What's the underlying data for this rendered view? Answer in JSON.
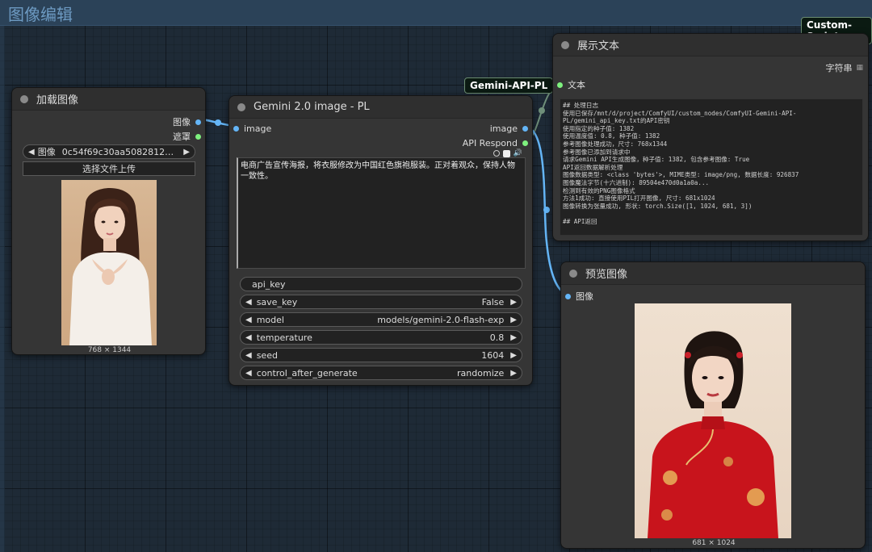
{
  "group": {
    "title": "图像编辑"
  },
  "badges": {
    "custom_scripts": "Custom-Scripts",
    "gemini_api": "Gemini-API-PL"
  },
  "load_image": {
    "title": "加载图像",
    "outputs": [
      "图像",
      "遮罩"
    ],
    "image_label": "图像",
    "image_value": "0c54f69c30aa508281210...",
    "upload_label": "选择文件上传",
    "dims": "768 × 1344"
  },
  "gemini": {
    "title": "Gemini 2.0 image - PL",
    "input_image": "image",
    "output_image": "image",
    "output_respond": "API Respond",
    "prompt": "电商广告宣传海报，将衣服修改为中国红色旗袍服装。正对着观众，保持人物一致性。",
    "api_key_label": "api_key",
    "widgets": [
      {
        "name": "save_key",
        "value": "False"
      },
      {
        "name": "model",
        "value": "models/gemini-2.0-flash-exp"
      },
      {
        "name": "temperature",
        "value": "0.8"
      },
      {
        "name": "seed",
        "value": "1604"
      },
      {
        "name": "control_after_generate",
        "value": "randomize"
      }
    ]
  },
  "show_text": {
    "title": "展示文本",
    "input_label": "文本",
    "output_label": "字符串",
    "log": "## 处理日志\n使用已保存/mnt/d/project/ComfyUI/custom_nodes/ComfyUI-Gemini-API-\nPL/gemini_api_key.txt的API密钥\n使用指定的种子值: 1382\n使用温度值: 0.8, 种子值: 1382\n参考图像处理成功，尺寸: 768x1344\n参考图像已添加到请求中\n请求Gemini API生成图像，种子值: 1382, 包含参考图像: True\nAPI返回数据解析处理\n图像数据类型: <class 'bytes'>, MIME类型: image/png, 数据长度: 926837\n图像魔法字节(十六进制): 89504e470d0a1a0a...\n检测到有效的PNG图像格式\n方法1成功: 直接使用PIL打开图像, 尺寸: 681x1024\n图像转换为张量成功, 形状: torch.Size([1, 1024, 681, 3])\n\n## API返回"
  },
  "preview": {
    "title": "预览图像",
    "input_label": "图像",
    "dims": "681 × 1024"
  }
}
